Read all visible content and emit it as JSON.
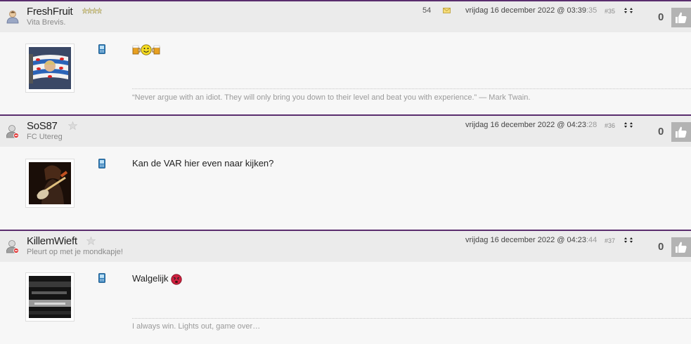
{
  "posts": [
    {
      "username": "FreshFruit",
      "user_title": "Vita Brevis.",
      "rank": "four-stars-icon",
      "message_count": "54",
      "date": "vrijdag 16 december 2022 @ 03:39",
      "seconds": ":35",
      "post_number": "#35",
      "score": "0",
      "message": "",
      "message_icons": [
        "beer-icon",
        "smiley-icon",
        "beer-icon"
      ],
      "signature": "“Never argue with an idiot. They will only bring you down to their level and beat you with experience.” — Mark Twain."
    },
    {
      "username": "SoS87",
      "user_title": "FC Utereg",
      "rank": "star-icon",
      "date": "vrijdag 16 december 2022 @ 04:23",
      "seconds": ":28",
      "post_number": "#36",
      "score": "0",
      "message": "Kan de VAR hier even naar kijken?",
      "signature": ""
    },
    {
      "username": "KillemWieft",
      "user_title": "Pleurt op met je mondkapje!",
      "rank": "star-icon",
      "date": "vrijdag 16 december 2022 @ 04:23",
      "seconds": ":44",
      "post_number": "#37",
      "score": "0",
      "message": "Walgelijk",
      "message_icons": [
        "angry-smiley-icon"
      ],
      "signature": "I always win. Lights out, game over…"
    }
  ],
  "colors": {
    "separator": "#5a2d6e",
    "header_bg": "#ebebeb",
    "body_bg": "#f7f7f7",
    "thumb_bg": "#b3b3b3"
  }
}
